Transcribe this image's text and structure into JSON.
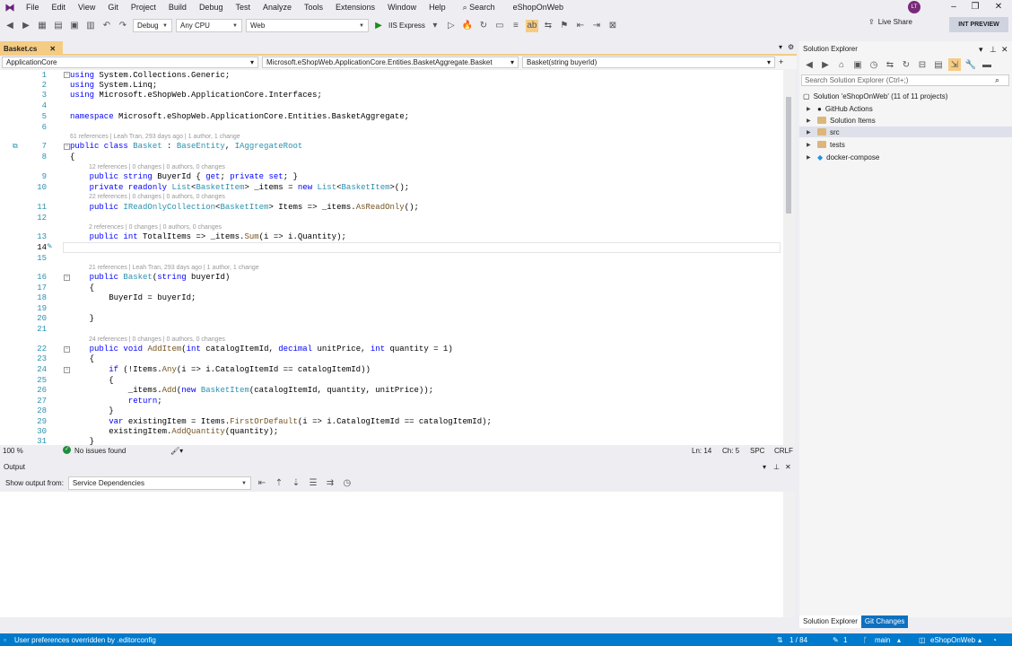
{
  "menu": {
    "items": [
      "File",
      "Edit",
      "View",
      "Git",
      "Project",
      "Build",
      "Debug",
      "Test",
      "Analyze",
      "Tools",
      "Extensions",
      "Window",
      "Help"
    ],
    "search_label": "Search",
    "solution_title": "eShopOnWeb",
    "avatar_initials": "LT"
  },
  "toolbar": {
    "config": "Debug",
    "platform": "Any CPU",
    "project": "Web",
    "run_label": "IIS Express",
    "live_share": "Live Share",
    "int_preview": "INT PREVIEW"
  },
  "tabs": {
    "active": "Basket.cs"
  },
  "navbar": {
    "project": "ApplicationCore",
    "type": "Microsoft.eShopWeb.ApplicationCore.Entities.BasketAggregate.Basket",
    "member": "Basket(string buyerId)"
  },
  "codelens": {
    "class": "61 references | Leah Tran, 293 days ago | 1 author, 1 change",
    "buyerid": "12 references | 0 changes | 0 authors, 0 changes",
    "items": "22 references | 0 changes | 0 authors, 0 changes",
    "totalitems": "2 references | 0 changes | 0 authors, 0 changes",
    "ctor": "21 references | Leah Tran, 293 days ago | 1 author, 1 change",
    "additem": "24 references | 0 changes | 0 authors, 0 changes"
  },
  "code": {
    "l1": "System.Collections.Generic;",
    "l2": "System.Linq;",
    "l3": "Microsoft.eShopWeb.ApplicationCore.Interfaces;",
    "l5": "Microsoft.eShopWeb.ApplicationCore.Entities.BasketAggregate;",
    "l7_class": "Basket",
    "l7_base": "BaseEntity",
    "l7_iface": "IAggregateRoot"
  },
  "editor_status": {
    "zoom": "100 %",
    "issues": "No issues found",
    "line": "Ln: 14",
    "col": "Ch: 5",
    "spc": "SPC",
    "crlf": "CRLF"
  },
  "output": {
    "title": "Output",
    "show_from_label": "Show output from:",
    "source": "Service Dependencies"
  },
  "solution_explorer": {
    "title": "Solution Explorer",
    "search_placeholder": "Search Solution Explorer (Ctrl+;)",
    "root": "Solution 'eShopOnWeb' (11 of 11 projects)",
    "items": [
      "GitHub Actions",
      "Solution Items",
      "src",
      "tests",
      "docker-compose"
    ],
    "tab_solution": "Solution Explorer",
    "tab_git": "Git Changes"
  },
  "statusbar": {
    "message": "User preferences overridden by .editorconfig",
    "position": "1 / 84",
    "edits": "1",
    "branch": "main",
    "repo": "eShopOnWeb"
  },
  "colors": {
    "accent": "#007acc",
    "tab_active": "#f5cc84",
    "keyword": "#0000ff",
    "type": "#2b91af"
  }
}
